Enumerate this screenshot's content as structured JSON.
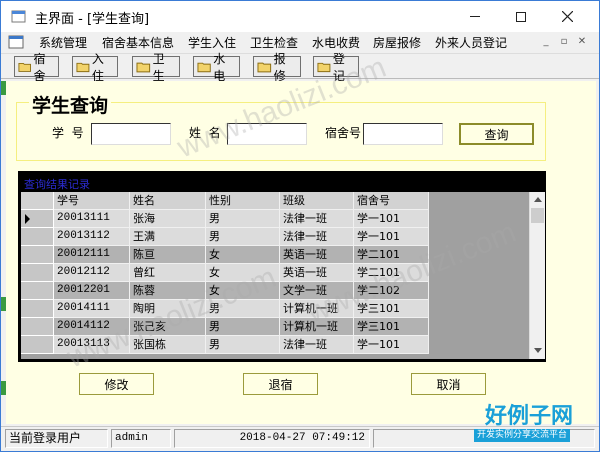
{
  "window": {
    "title": "主界面 - [学生查询]",
    "accent": "#3a7bd5"
  },
  "menu": [
    {
      "label": "系统管理"
    },
    {
      "label": "宿舍基本信息"
    },
    {
      "label": "学生入住"
    },
    {
      "label": "卫生检查"
    },
    {
      "label": "水电收费"
    },
    {
      "label": "房屋报修"
    },
    {
      "label": "外来人员登记"
    }
  ],
  "toolbar": [
    {
      "label": "宿舍",
      "icon": "folder-icon"
    },
    {
      "label": "入住",
      "icon": "folder-icon"
    },
    {
      "label": "卫生",
      "icon": "folder-icon"
    },
    {
      "label": "水电",
      "icon": "folder-icon"
    },
    {
      "label": "报修",
      "icon": "folder-icon"
    },
    {
      "label": "登记",
      "icon": "folder-icon"
    }
  ],
  "form": {
    "title": "学生查询",
    "student_id_label": "学  号",
    "student_id_value": "",
    "name_label": "姓  名",
    "name_value": "",
    "dorm_label": "宿舍号",
    "dorm_value": "",
    "search_button": "查询"
  },
  "grid": {
    "caption": "查询结果记录",
    "columns": [
      "学号",
      "姓名",
      "性别",
      "班级",
      "宿舍号"
    ],
    "rows": [
      [
        "20013111",
        "张海",
        "男",
        "法律一班",
        "学一101"
      ],
      [
        "20013112",
        "王满",
        "男",
        "法律一班",
        "学一101"
      ],
      [
        "20012111",
        "陈亘",
        "女",
        "英语一班",
        "学二101"
      ],
      [
        "20012112",
        "曾红",
        "女",
        "英语一班",
        "学二101"
      ],
      [
        "20012201",
        "陈蓉",
        "女",
        "文学一班",
        "学二102"
      ],
      [
        "20014111",
        "陶明",
        "男",
        "计算机一班",
        "学三101"
      ],
      [
        "20014112",
        "张己亥",
        "男",
        "计算机一班",
        "学三101"
      ],
      [
        "20013113",
        "张国栋",
        "男",
        "法律一班",
        "学一101"
      ]
    ]
  },
  "actions": {
    "edit": "修改",
    "checkout": "退宿",
    "cancel": "取消"
  },
  "status": {
    "user_label": "当前登录用户",
    "user": "admin",
    "datetime": "2018-04-27 07:49:12"
  },
  "watermark": {
    "site": "www.haolizi.com",
    "brand": "好例子网",
    "brand_sub": "开发实例分享交流平台"
  }
}
